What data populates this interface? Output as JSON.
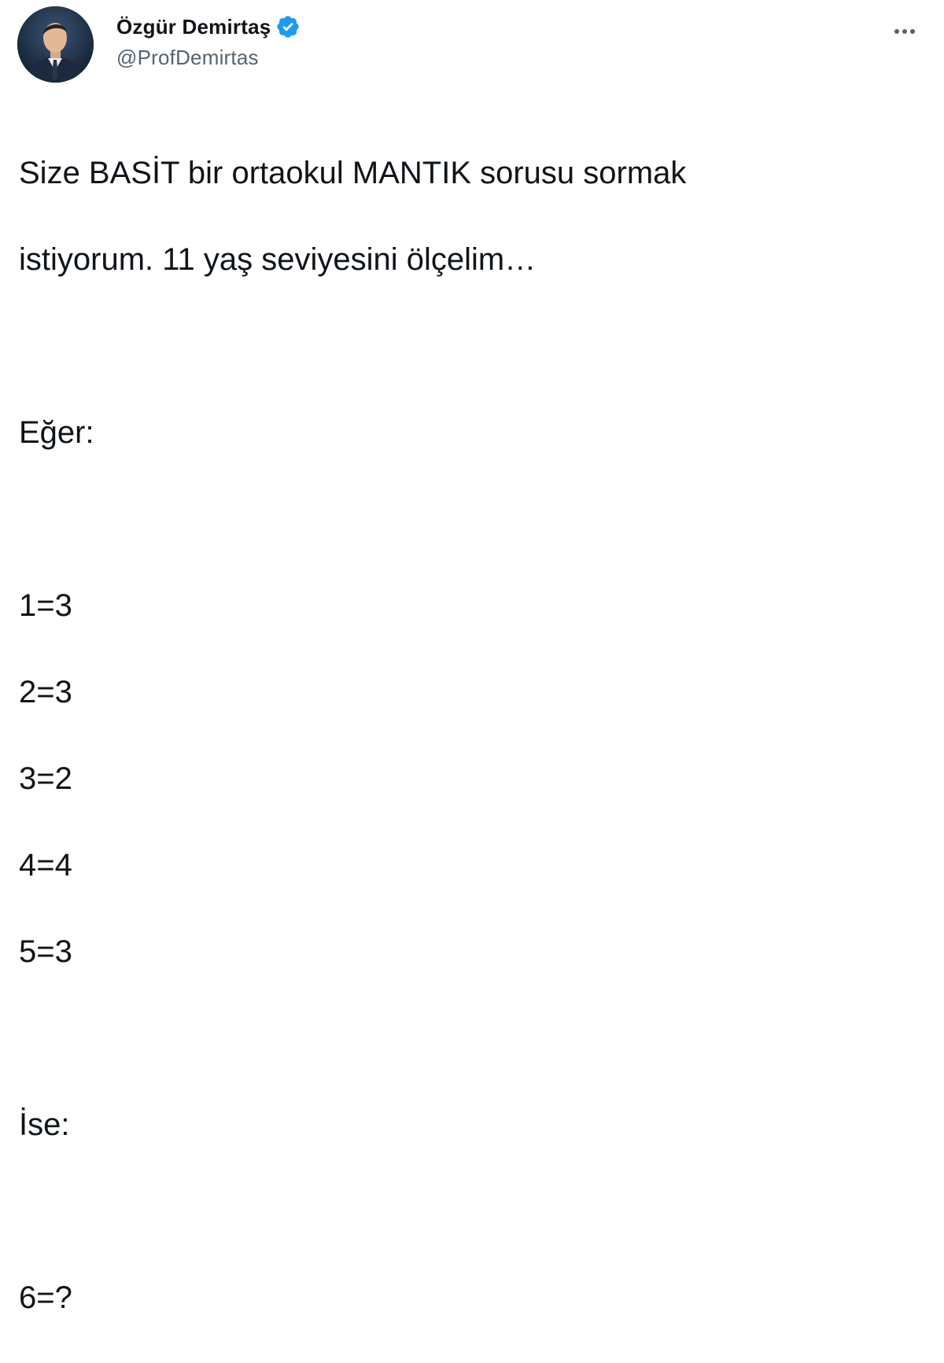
{
  "tweet": {
    "author": {
      "display_name": "Özgür Demirtaş",
      "handle": "@ProfDemirtas",
      "verified_icon": "verified-badge-icon",
      "verified_color": "#1d9bf0"
    },
    "more_icon": "more-horizontal-icon",
    "text_lines": {
      "l1": "Size BASİT bir ortaokul MANTIK sorusu sormak",
      "l2": "istiyorum. 11 yaş seviyesini ölçelim…",
      "l3": "Eğer:",
      "l4": "1=3",
      "l5": "2=3",
      "l6": "3=2",
      "l7": "4=4",
      "l8": "5=3",
      "l9": "İse:",
      "l10": "6=?"
    }
  }
}
